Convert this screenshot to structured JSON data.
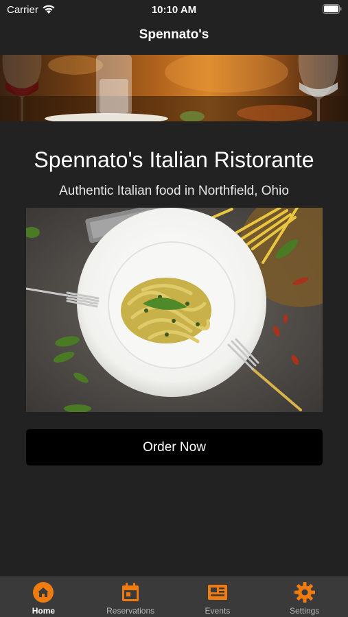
{
  "status_bar": {
    "carrier": "Carrier",
    "time": "10:10 AM"
  },
  "nav": {
    "title": "Spennato's"
  },
  "hero": {
    "banner_icon": "restaurant-interior-photo",
    "name": "Spennato's Italian Ristorante",
    "tagline": "Authentic Italian food in Northfield, Ohio",
    "food_photo_icon": "pasta-dish-photo"
  },
  "actions": {
    "order_label": "Order Now"
  },
  "tab_bar": {
    "accent_color": "#f07b10",
    "items": [
      {
        "label": "Home",
        "icon": "home-icon",
        "active": true
      },
      {
        "label": "Reservations",
        "icon": "calendar-icon",
        "active": false
      },
      {
        "label": "Events",
        "icon": "newspaper-icon",
        "active": false
      },
      {
        "label": "Settings",
        "icon": "gear-icon",
        "active": false
      }
    ]
  }
}
